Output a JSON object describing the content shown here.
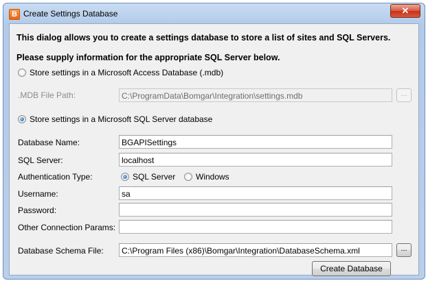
{
  "window": {
    "title": "Create Settings Database",
    "app_icon_letter": "B",
    "close_glyph": "✕"
  },
  "intro": {
    "line1": "This dialog allows you to create a settings database to store a list of sites and SQL Servers.",
    "line2": "Please supply information for the appropriate SQL Server below."
  },
  "access_option": {
    "label": "Store settings in a Microsoft Access Database (.mdb)",
    "selected": false,
    "mdb_label": ".MDB File Path:",
    "mdb_value": "C:\\ProgramData\\Bomgar\\Integration\\settings.mdb",
    "browse_label": "..."
  },
  "sql_option": {
    "label": "Store settings in a Microsoft SQL Server database",
    "selected": true
  },
  "form": {
    "database_name_label": "Database Name:",
    "database_name_value": "BGAPISettings",
    "sql_server_label": "SQL Server:",
    "sql_server_value": "localhost",
    "auth_type_label": "Authentication Type:",
    "auth_sql_label": "SQL Server",
    "auth_windows_label": "Windows",
    "auth_selected": "SQL Server",
    "username_label": "Username:",
    "username_value": "sa",
    "password_label": "Password:",
    "password_value": "",
    "other_params_label": "Other Connection Params:",
    "other_params_value": "",
    "schema_file_label": "Database Schema File:",
    "schema_file_value": "C:\\Program Files (x86)\\Bomgar\\Integration\\DatabaseSchema.xml",
    "schema_browse_label": "..."
  },
  "actions": {
    "create_label": "Create Database"
  }
}
